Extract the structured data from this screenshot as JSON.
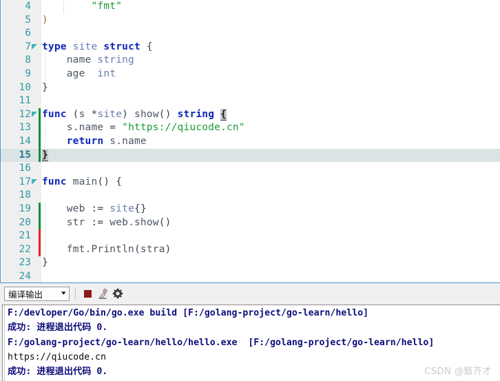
{
  "editor": {
    "language": "go",
    "first_visible_line": 4,
    "last_visible_line": 24,
    "current_line": 15,
    "colors": {
      "keyword": "#0f25b8",
      "type": "#6a7bb5",
      "string": "#1a9b35",
      "line_number": "#2e9ba4",
      "current_line_bg": "#dce3e5",
      "gutter_bg": "#efefef",
      "vcs_added": "#0b8f3a",
      "vcs_modified": "#ed2020",
      "focus_border": "#4a90d9"
    },
    "lines": [
      {
        "num": "4",
        "text": "        \"fmt\""
      },
      {
        "num": "5",
        "text": ")"
      },
      {
        "num": "6",
        "text": ""
      },
      {
        "num": "7",
        "text": "type site struct {"
      },
      {
        "num": "8",
        "text": "    name string"
      },
      {
        "num": "9",
        "text": "    age  int"
      },
      {
        "num": "10",
        "text": "}"
      },
      {
        "num": "11",
        "text": ""
      },
      {
        "num": "12",
        "text": "func (s *site) show() string {"
      },
      {
        "num": "13",
        "text": "    s.name = \"https://qiucode.cn\""
      },
      {
        "num": "14",
        "text": "    return s.name"
      },
      {
        "num": "15",
        "text": "}"
      },
      {
        "num": "16",
        "text": ""
      },
      {
        "num": "17",
        "text": "func main() {"
      },
      {
        "num": "18",
        "text": ""
      },
      {
        "num": "19",
        "text": "    web := site{}"
      },
      {
        "num": "20",
        "text": "    str := web.show()"
      },
      {
        "num": "21",
        "text": ""
      },
      {
        "num": "22",
        "text": "    fmt.Println(stra)"
      },
      {
        "num": "23",
        "text": "}"
      },
      {
        "num": "24",
        "text": ""
      }
    ]
  },
  "output_panel": {
    "selector": {
      "value": "编译输出",
      "caret_icon": "chevron-down-icon",
      "options": [
        "编译输出"
      ]
    },
    "buttons": [
      {
        "name": "stop-button",
        "icon": "stop-square-icon",
        "tooltip": "停止"
      },
      {
        "name": "clear-button",
        "icon": "eraser-icon",
        "tooltip": "清空"
      },
      {
        "name": "settings-button",
        "icon": "gear-icon",
        "tooltip": "设置"
      }
    ],
    "console_lines": [
      {
        "text": "F:/devloper/Go/bin/go.exe build [F:/golang-project/go-learn/hello]",
        "style": "navy"
      },
      {
        "text": "成功: 进程退出代码 0.",
        "style": "navy"
      },
      {
        "text": "F:/golang-project/go-learn/hello/hello.exe  [F:/golang-project/go-learn/hello]",
        "style": "navy"
      },
      {
        "text": "https://qiucode.cn",
        "style": "plain"
      },
      {
        "text": "成功: 进程退出代码 0.",
        "style": "navy"
      }
    ]
  },
  "watermark": {
    "text": "CSDN @甄齐才"
  }
}
